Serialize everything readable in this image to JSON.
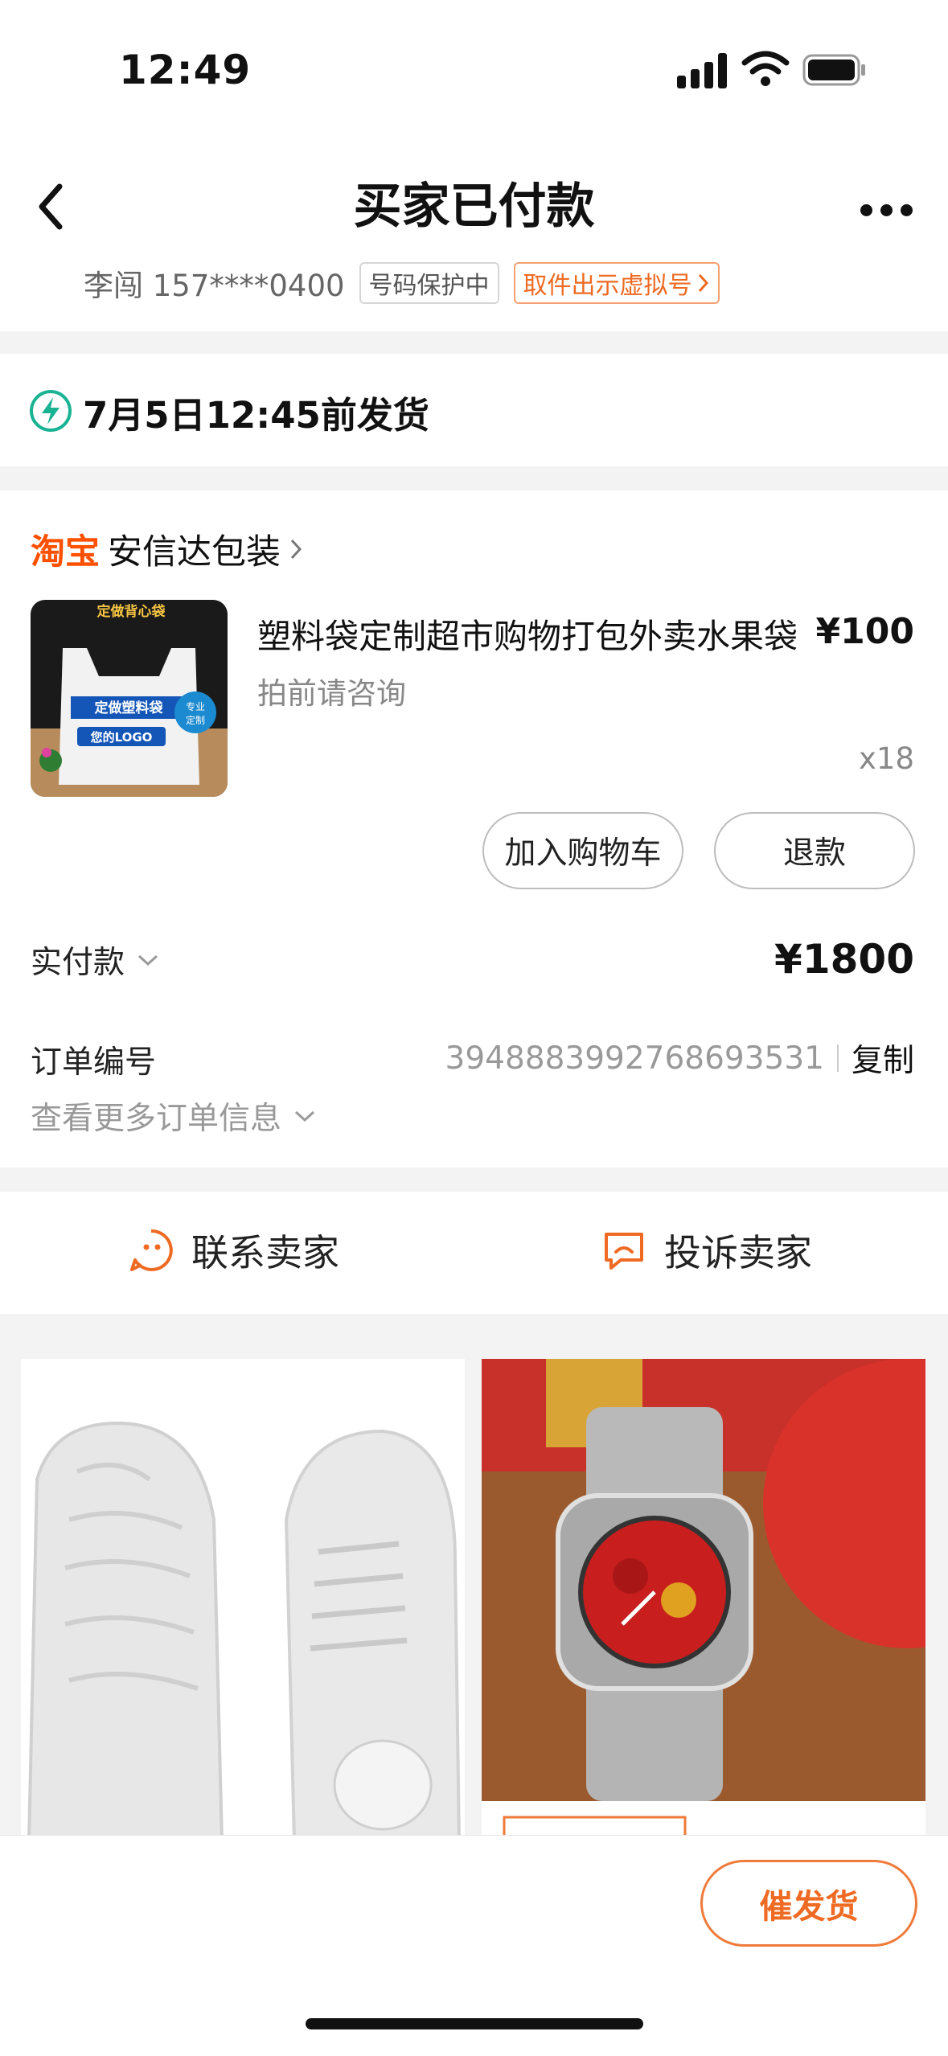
{
  "status_bar": {
    "time": "12:49"
  },
  "header": {
    "title": "买家已付款",
    "buyer": "李闯 157****0400",
    "privacy_tag": "号码保护中",
    "virtual_number_tag": "取件出示虚拟号"
  },
  "shipping": {
    "deadline": "7月5日12:45前发货"
  },
  "order": {
    "platform": "淘宝",
    "shop_name": "安信达包装",
    "product": {
      "title": "塑料袋定制超市购物打包外卖水果袋",
      "price": "¥100",
      "note": "拍前请咨询",
      "quantity": "x18",
      "thumb_text": [
        "定做背心袋",
        "定做塑料袋",
        "您的LOGO",
        "专业",
        "定制"
      ]
    },
    "add_to_cart_label": "加入购物车",
    "refund_label": "退款",
    "paid_label": "实付款",
    "paid_amount": "¥1800",
    "order_no_label": "订单编号",
    "order_no": "3948883992768693531",
    "copy_label": "复制",
    "more_info_label": "查看更多订单信息"
  },
  "contact": {
    "contact_seller_label": "联系卖家",
    "complain_seller_label": "投诉卖家"
  },
  "bottom_bar": {
    "urge_label": "催发货"
  },
  "colors": {
    "brand_orange": "#ff5000",
    "accent_orange": "#ef6a22",
    "ship_green": "#19b394"
  }
}
